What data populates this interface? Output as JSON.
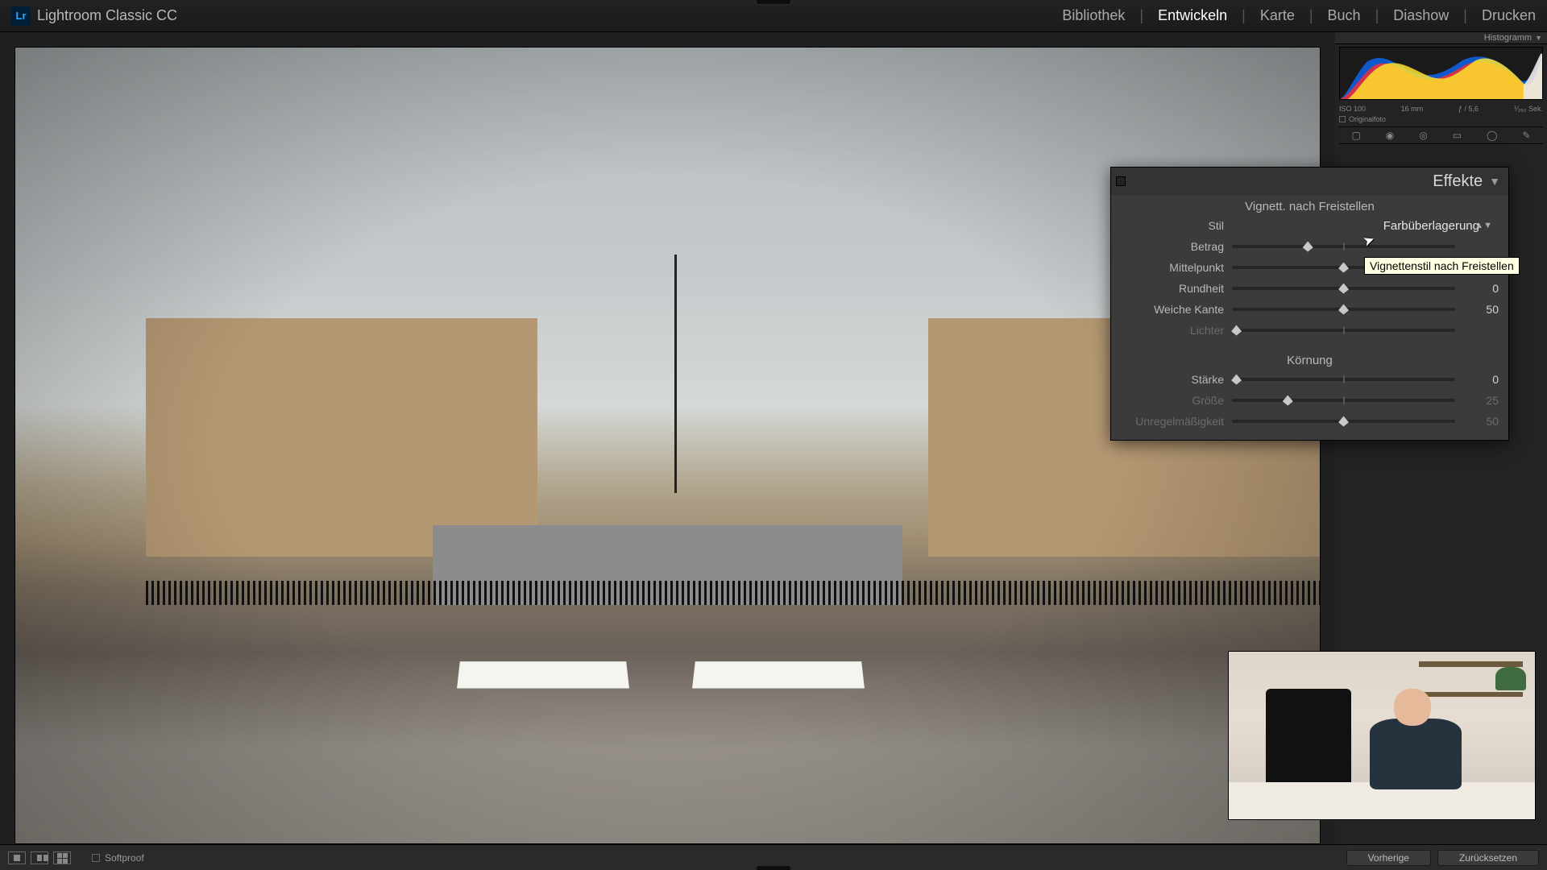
{
  "app": {
    "badge": "Lr",
    "title": "Lightroom Classic CC"
  },
  "modules": {
    "items": [
      "Bibliothek",
      "Entwickeln",
      "Karte",
      "Buch",
      "Diashow",
      "Drucken"
    ],
    "active_index": 1
  },
  "histogram": {
    "title": "Histogramm",
    "meta": {
      "iso": "ISO 100",
      "focal": "16 mm",
      "aperture": "ƒ / 5,6",
      "shutter": "⅟₂₅₀ Sek."
    },
    "original_label": "Originalfoto"
  },
  "toolstrip_icons": [
    "crop-icon",
    "spot-icon",
    "redeye-icon",
    "grad-icon",
    "radial-icon",
    "brush-icon"
  ],
  "effects": {
    "panel_title": "Effekte",
    "vignette": {
      "heading": "Vignett. nach Freistellen",
      "style_label": "Stil",
      "style_value": "Farbüberlagerung",
      "rows": [
        {
          "label": "Betrag",
          "value": "",
          "pos": 34,
          "dim": false
        },
        {
          "label": "Mittelpunkt",
          "value": "50",
          "pos": 50,
          "dim": false
        },
        {
          "label": "Rundheit",
          "value": "0",
          "pos": 50,
          "dim": false
        },
        {
          "label": "Weiche Kante",
          "value": "50",
          "pos": 50,
          "dim": false
        },
        {
          "label": "Lichter",
          "value": "",
          "pos": 2,
          "dim": true
        }
      ]
    },
    "grain": {
      "heading": "Körnung",
      "rows": [
        {
          "label": "Stärke",
          "value": "0",
          "pos": 2,
          "dim": false
        },
        {
          "label": "Größe",
          "value": "25",
          "pos": 25,
          "dim": true
        },
        {
          "label": "Unregelmäßigkeit",
          "value": "50",
          "pos": 50,
          "dim": true
        }
      ]
    }
  },
  "tooltip": "Vignettenstil nach Freistellen",
  "bottom": {
    "softproof": "Softproof",
    "prev": "Vorherige",
    "reset": "Zurücksetzen"
  }
}
